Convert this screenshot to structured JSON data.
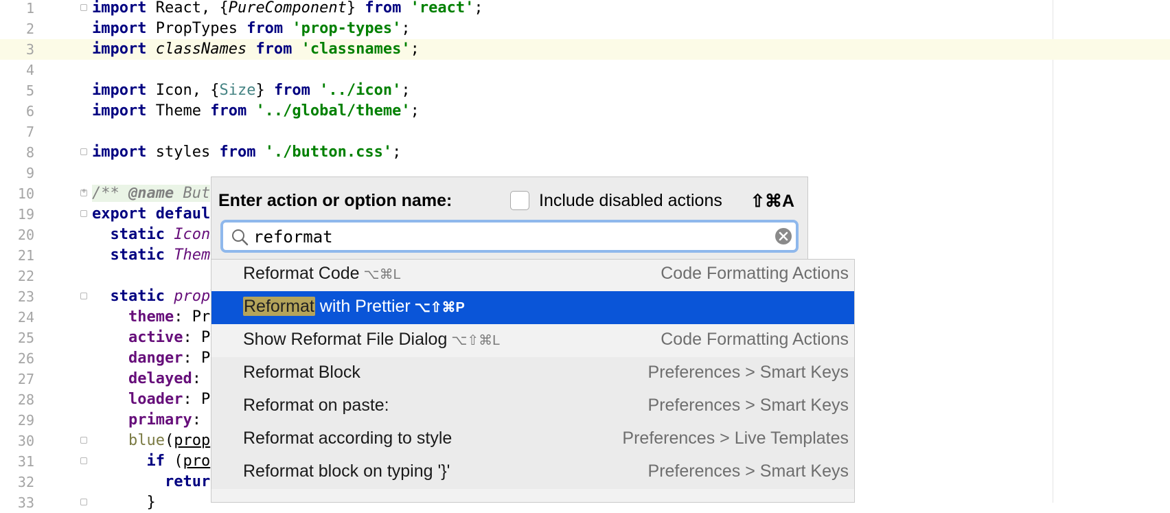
{
  "editor": {
    "current_line": 3,
    "lines": [
      {
        "num": "1",
        "html": "<span class=\"kw\">import</span> React, {<span class=\"it\">PureComponent</span>} <span class=\"kw\">from</span> <span class=\"str\">'react'</span>;",
        "fold": "open"
      },
      {
        "num": "2",
        "html": "<span class=\"kw\">import</span> PropTypes <span class=\"kw\">from</span> <span class=\"str\">'prop-types'</span>;"
      },
      {
        "num": "3",
        "html": "<span class=\"kw\">import</span> <span class=\"it\">classNames</span> <span class=\"kw\">from</span> <span class=\"str\">'classnames'</span>;"
      },
      {
        "num": "4",
        "html": ""
      },
      {
        "num": "5",
        "html": "<span class=\"kw\">import</span> Icon, {<span class=\"teal\">Size</span>} <span class=\"kw\">from</span> <span class=\"str\">'../icon'</span>;"
      },
      {
        "num": "6",
        "html": "<span class=\"kw\">import</span> Theme <span class=\"kw\">from</span> <span class=\"str\">'../global/theme'</span>;"
      },
      {
        "num": "7",
        "html": ""
      },
      {
        "num": "8",
        "html": "<span class=\"kw\">import</span> styles <span class=\"kw\">from</span> <span class=\"str\">'./button.css'</span>;",
        "fold": "close"
      },
      {
        "num": "9",
        "html": ""
      },
      {
        "num": "10",
        "html": "<span class=\"cmtbg\"><span class=\"cmt\">/** </span><span class=\"cmt\" style=\"font-weight:bold\">@name</span><span class=\"cmt\"> But</span></span>",
        "fold": "plus"
      },
      {
        "num": "19",
        "html": "<span class=\"kw\">export</span> <span class=\"kw\">defaul</span><span class=\"ghost\">t class Button extends PureComponent {</span>",
        "fold": "open"
      },
      {
        "num": "20",
        "html": "  <span class=\"kw\">static</span> <span class=\"it prop\" style=\"font-weight:normal\">Icon</span><span class=\"ghost\"> = Size;</span>"
      },
      {
        "num": "21",
        "html": "  <span class=\"kw\">static</span> <span class=\"it prop\" style=\"font-weight:normal\">Them</span><span class=\"ghost\"> = Theme;</span>"
      },
      {
        "num": "22",
        "html": ""
      },
      {
        "num": "23",
        "html": "  <span class=\"kw\">static</span> <span class=\"it prop\" style=\"font-weight:normal\">prop</span><span class=\"ghost\">Types = {</span>",
        "fold": "open"
      },
      {
        "num": "24",
        "html": "    <span class=\"prop\">theme</span>: Prop"
      },
      {
        "num": "25",
        "html": "    <span class=\"prop\">active</span>: P<span class=\"ghost\">ropTypes.bool,</span>"
      },
      {
        "num": "26",
        "html": "    <span class=\"prop\">danger</span>: P<span class=\"ghost\">ropTypes.bool,</span>"
      },
      {
        "num": "27",
        "html": "    <span class=\"prop\">delayed</span>: <span class=\"ghost\">PropTypes.bool,</span>"
      },
      {
        "num": "28",
        "html": "    <span class=\"prop\">loader</span>: P<span class=\"ghost\">ropTypes.bool,</span>"
      },
      {
        "num": "29",
        "html": "    <span class=\"prop\">primary</span>: <span class=\"ghost\">PropTypes.bool,</span>"
      },
      {
        "num": "30",
        "html": "    <span class=\"fnc\">blue</span>(<u>prop</u><span class=\"ghost\">s, propName) {</span>",
        "fold": "open"
      },
      {
        "num": "31",
        "html": "      <span class=\"kw\">if</span> (<u>pro</u><span class=\"ghost\">pName in props) {</span>",
        "fold": "open"
      },
      {
        "num": "32",
        "html": "        <span class=\"kw\">retur</span><span class=\"ghost\">n new Error(`${propName} prop is deprecated. Use 'primary' inste</span><span class=\"str\">ad`</span>);"
      },
      {
        "num": "33",
        "html": "      }",
        "fold": "close"
      }
    ]
  },
  "popup": {
    "title": "Enter action or option name:",
    "include_disabled_label": "Include disabled actions",
    "include_disabled_shortcut": "⇧⌘A",
    "include_disabled_checked": false,
    "search_value": "reformat",
    "results": [
      {
        "pre": "",
        "match": "Reformat",
        "post": " Code",
        "shortcut": "⌥⌘L",
        "group": "Code Formatting Actions",
        "highlight_match": false
      },
      {
        "pre": "",
        "match": "Reformat",
        "post": " with Prettier",
        "shortcut": "⌥⇧⌘P",
        "group": "",
        "highlight_match": true,
        "selected": true
      },
      {
        "pre": "Show ",
        "match": "Reformat",
        "post": " File Dialog",
        "shortcut": "⌥⇧⌘L",
        "group": "Code Formatting Actions",
        "highlight_match": false
      },
      {
        "pre": "",
        "match": "Reformat",
        "post": " Block",
        "shortcut": "",
        "group": "Preferences > Smart Keys",
        "highlight_match": false
      },
      {
        "pre": "",
        "match": "Reformat",
        "post": " on paste:",
        "shortcut": "",
        "group": "Preferences > Smart Keys",
        "highlight_match": false
      },
      {
        "pre": "",
        "match": "Reformat",
        "post": " according to style",
        "shortcut": "",
        "group": "Preferences > Live Templates",
        "highlight_match": false
      },
      {
        "pre": "",
        "match": "Reformat",
        "post": " block on typing '}'",
        "shortcut": "",
        "group": "Preferences > Smart Keys",
        "highlight_match": false
      }
    ]
  },
  "colors": {
    "selection": "#0a55d8",
    "search_focus": "#8fb8ec",
    "current_line": "#fcfbe7"
  }
}
